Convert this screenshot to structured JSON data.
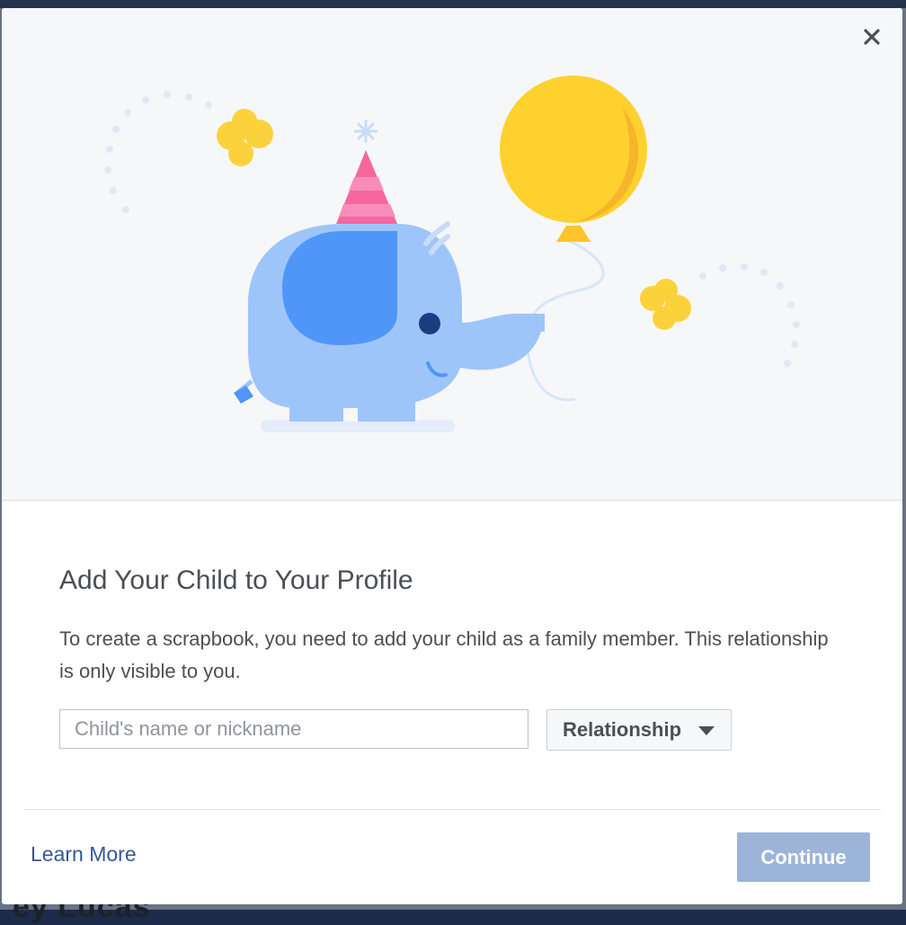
{
  "dialog": {
    "title": "Add Your Child to Your Profile",
    "description": "To create a scrapbook, you need to add your child as a family member. This relationship is only visible to you.",
    "name_input": {
      "placeholder": "Child's name or nickname",
      "value": ""
    },
    "relationship_select": {
      "label": "Relationship",
      "icon": "caret-down-icon"
    },
    "learn_more_label": "Learn More",
    "continue_label": "Continue",
    "close_icon": "close-icon"
  },
  "background_page": {
    "partial_text": "ey Lucas"
  },
  "colors": {
    "elephant_body": "#9ec5fa",
    "elephant_ear": "#5096f9",
    "balloon": "#ffd12f",
    "butterfly": "#fcd23c",
    "party_hat": "#f5679d",
    "link": "#365899",
    "continue_disabled": "#9cb4d8"
  }
}
